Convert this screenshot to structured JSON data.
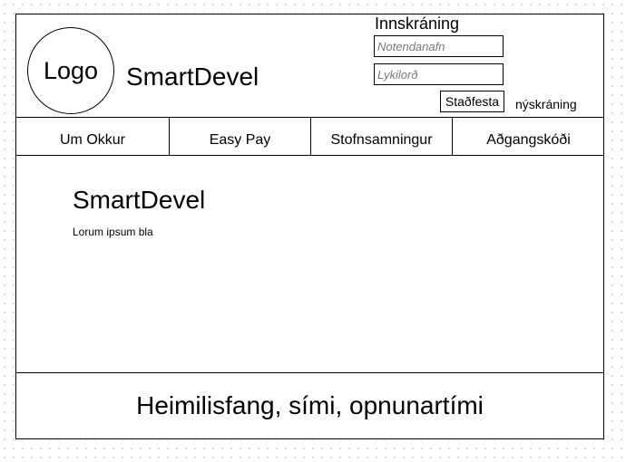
{
  "header": {
    "logo_label": "Logo",
    "site_name": "SmartDevel",
    "login": {
      "title": "Innskráning",
      "username_placeholder": "Notendanafn",
      "password_placeholder": "Lykilorð",
      "confirm_label": "Staðfesta",
      "register_label": "nýskráning"
    }
  },
  "nav": {
    "items": [
      {
        "label": "Um Okkur"
      },
      {
        "label": "Easy Pay"
      },
      {
        "label": "Stofnsamningur"
      },
      {
        "label": "Aðgangskóði"
      }
    ]
  },
  "main": {
    "title": "SmartDevel",
    "text": "Lorum ipsum bla"
  },
  "footer": {
    "text": "Heimilisfang, sími, opnunartími"
  }
}
